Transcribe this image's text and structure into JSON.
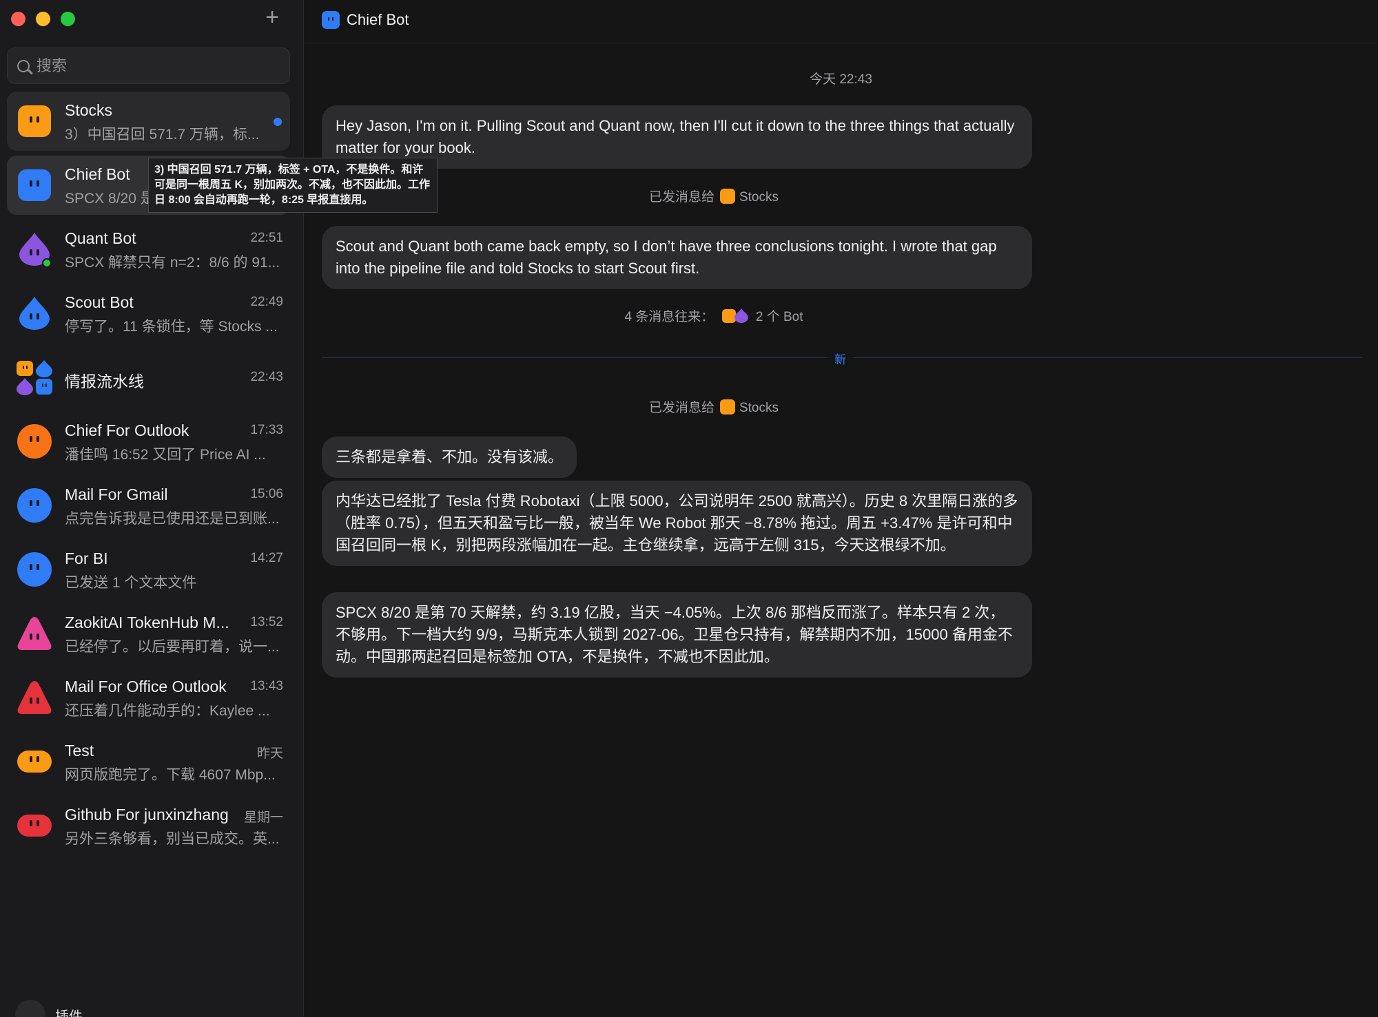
{
  "sidebar": {
    "search_placeholder": "搜索",
    "new_label": "+",
    "plugin_label": "插件",
    "items": [
      {
        "name": "Stocks",
        "preview": "3）中国召回 571.7 万辆，标...",
        "time": "",
        "avatar": "orange-square-bot-icon",
        "unread": true
      },
      {
        "name": "Chief Bot",
        "preview": "SPCX 8/20 是",
        "time": "",
        "avatar": "blue-square-bot-icon"
      },
      {
        "name": "Quant Bot",
        "preview": "SPCX 解禁只有 n=2：8/6 的 91...",
        "time": "22:51",
        "avatar": "purple-drop-bot-icon"
      },
      {
        "name": "Scout Bot",
        "preview": "停写了。11 条锁住，等 Stocks ...",
        "time": "22:49",
        "avatar": "blue-drop-bot-icon"
      },
      {
        "name": "情报流水线",
        "preview": "",
        "time": "22:43",
        "avatar": "group-bots-icon"
      },
      {
        "name": "Chief For Outlook",
        "preview": "潘佳鸣 16:52 又回了 Price AI ...",
        "time": "17:33",
        "avatar": "orange-circle-bot-icon"
      },
      {
        "name": "Mail For Gmail",
        "preview": "点完告诉我是已使用还是已到账...",
        "time": "15:06",
        "avatar": "blue-circle-bot-icon"
      },
      {
        "name": "For BI",
        "preview": "已发送 1 个文本文件",
        "time": "14:27",
        "avatar": "blue-circle-bot-icon"
      },
      {
        "name": "ZaokitAI TokenHub M...",
        "preview": "已经停了。以后要再盯着，说一...",
        "time": "13:52",
        "avatar": "pink-triangle-bot-icon"
      },
      {
        "name": "Mail For Office Outlook",
        "preview": "还压着几件能动手的：Kaylee ...",
        "time": "13:43",
        "avatar": "red-triangle-bot-icon"
      },
      {
        "name": "Test",
        "preview": "网页版跑完了。下载 4607 Mbp...",
        "time": "昨天",
        "avatar": "orange-pill-bot-icon"
      },
      {
        "name": "Github For junxinzhang",
        "preview": "另外三条够看，别当已成交。英...",
        "time": "星期一",
        "avatar": "red-pill-bot-icon"
      }
    ]
  },
  "tooltip": {
    "text": "3) 中国召回 571.7 万辆，标签 + OTA，不是换件。和许可是同一根周五 K，别加两次。不减，也不因此加。工作日 8:00 会自动再跑一轮，8:25 早报直接用。"
  },
  "chat": {
    "title": "Chief Bot",
    "timestamp": "今天 22:43",
    "messages": [
      {
        "text": "Hey Jason, I'm on it. Pulling Scout and Quant now, then I'll cut it down to the three things that actually matter for your book."
      },
      {
        "text": "Scout and Quant both came back empty, so I don’t have three conclusions tonight. I wrote that gap into the pipeline file and told Stocks to start Scout first."
      },
      {
        "text": "三条都是拿着、不加。没有该减。"
      },
      {
        "text": "内华达已经批了 Tesla 付费 Robotaxi（上限 5000，公司说明年 2500 就高兴）。历史 8 次里隔日涨的多（胜率 0.75），但五天和盈亏比一般，被当年 We Robot 那天 −8.78% 拖过。周五 +3.47% 是许可和中国召回同一根 K，别把两段涨幅加在一起。主仓继续拿，远高于左侧 315，今天这根绿不加。"
      },
      {
        "text": "SPCX 8/20 是第 70 天解禁，约 3.19 亿股，当天 −4.05%。上次 8/6 那档反而涨了。样本只有 2 次，不够用。下一档大约 9/9，马斯克本人锁到 2027-06。卫星仓只持有，解禁期内不加，15000 备用金不动。中国那两起召回是标签加 OTA，不是换件，不减也不因此加。"
      }
    ],
    "sent_to_prefix": "已发消息给",
    "sent_to_target": "Stocks",
    "exchange_prefix": "4 条消息往来：",
    "exchange_target": "2 个 Bot",
    "new_label": "新"
  },
  "colors": {
    "accent_blue": "#2f7cf6",
    "orange": "#fb9a14",
    "purple": "#8b55e0",
    "pink": "#e8459a",
    "red": "#e5323b"
  }
}
